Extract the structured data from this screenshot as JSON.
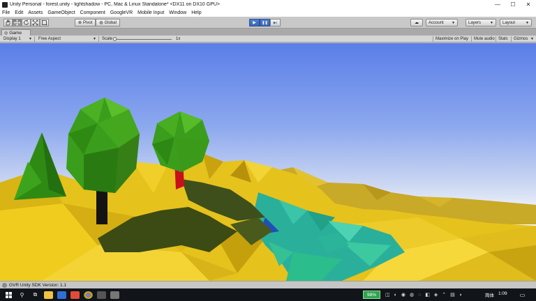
{
  "window": {
    "title": "Unity Personal - forest.unity - lightshadow - PC, Mac & Linux Standalone* <DX11 on DX10 GPU>",
    "minimize": "—",
    "maximize": "☐",
    "close": "✕"
  },
  "menu": [
    "File",
    "Edit",
    "Assets",
    "GameObject",
    "Component",
    "GoogleVR",
    "Mobile Input",
    "Window",
    "Help"
  ],
  "toolbar": {
    "tools": [
      "hand-tool",
      "move-tool",
      "rotate-tool",
      "scale-tool",
      "rect-tool"
    ],
    "active_tool": "move-tool",
    "pivot_label": "Pivot",
    "global_label": "Global",
    "play_label": "▶",
    "pause_label": "❚❚",
    "step_label": "▶|",
    "play_active": true,
    "pause_active": true,
    "cloud_label": "☁",
    "account_label": "Account",
    "layers_label": "Layers",
    "layout_label": "Layout"
  },
  "game_tab": {
    "label": "Game",
    "display": "Display 1",
    "aspect": "Free Aspect",
    "scale_label": "Scale",
    "scale_value": "1x",
    "scale_fraction": 0.0,
    "maximize_on_play": "Maximize on Play",
    "mute_audio": "Mute audio",
    "stats": "Stats",
    "gizmos": "Gizmos"
  },
  "status": {
    "text": "GVR Unity SDK Version: 1.1"
  },
  "taskbar": {
    "battery": "98%",
    "language": "简体",
    "time": "1:09",
    "accent": "#2ea44f"
  },
  "colors": {
    "sky_top": "#5a7fe6",
    "sky_bottom": "#e9eef8",
    "terrain_yellow": "#e6c21c",
    "water_teal": "#2ab09a",
    "tree_green": "#3a9e1c",
    "trunk_red": "#c8101a"
  }
}
